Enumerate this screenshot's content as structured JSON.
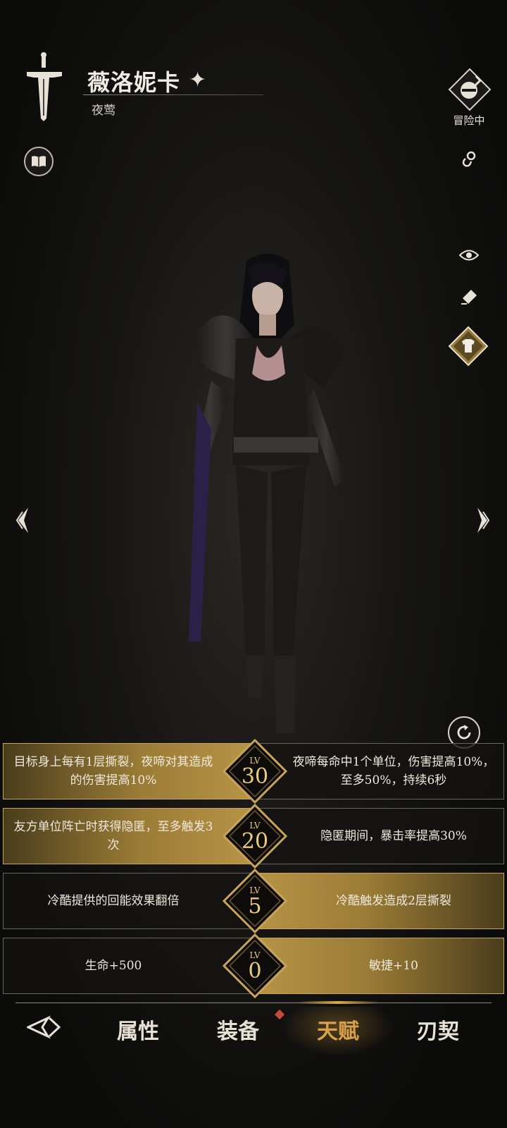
{
  "header": {
    "character_name": "薇洛妮卡",
    "character_title": "夜莺",
    "status_label": "冒险中"
  },
  "icons": {
    "book": "book-icon",
    "link": "link-icon",
    "eye": "eye-icon",
    "eraser": "eraser-icon",
    "outfit": "shirt-icon",
    "refresh": "refresh-icon",
    "prev": "prev-arrow-icon",
    "next": "next-arrow-icon"
  },
  "talents": [
    {
      "level_prefix": "LV",
      "level": "30",
      "left": "目标身上每有1层撕裂，夜啼对其造成的伤害提高10%",
      "right": "夜啼每命中1个单位，伤害提高10%，至多50%，持续6秒",
      "active_side": "left"
    },
    {
      "level_prefix": "LV",
      "level": "20",
      "left": "友方单位阵亡时获得隐匿，至多触发3次",
      "right": "隐匿期间，暴击率提高30%",
      "active_side": "left"
    },
    {
      "level_prefix": "LV",
      "level": "5",
      "left": "冷酷提供的回能效果翻倍",
      "right": "冷酷触发造成2层撕裂",
      "active_side": "right"
    },
    {
      "level_prefix": "LV",
      "level": "0",
      "left": "生命+500",
      "right": "敏捷+10",
      "active_side": "right"
    }
  ],
  "nav": {
    "items": [
      "属性",
      "装备",
      "天赋",
      "刃契"
    ],
    "active_index": 2
  },
  "colors": {
    "gold": "#c4a45c",
    "active_nav": "#d9a24a"
  }
}
